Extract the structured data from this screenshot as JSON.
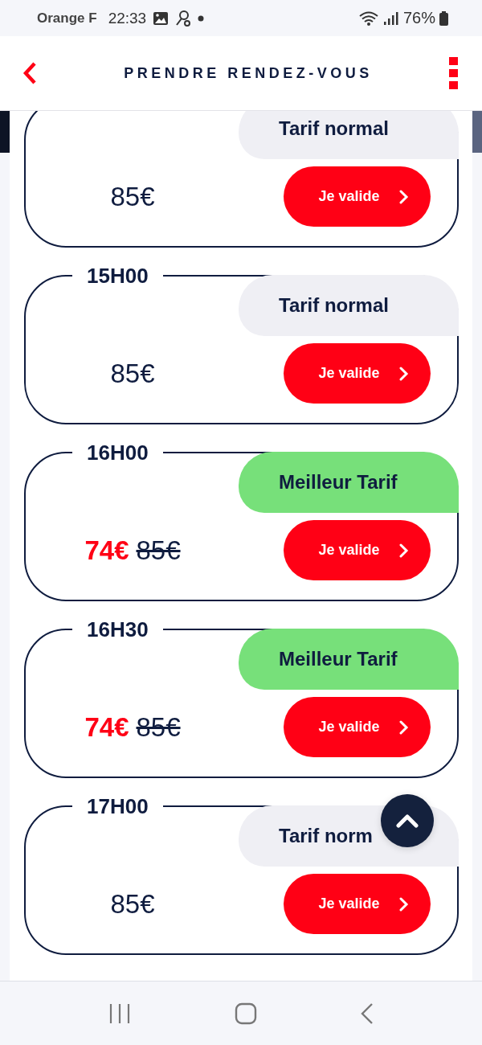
{
  "status_bar": {
    "carrier": "Orange F",
    "time": "22:33",
    "battery": "76%"
  },
  "header": {
    "title": "PRENDRE RENDEZ-VOUS"
  },
  "slots": [
    {
      "price": "85€",
      "badge": {
        "kind": "normal",
        "label": "Tarif normal"
      },
      "button": "Je valide"
    },
    {
      "time": "15H00",
      "price": "85€",
      "badge": {
        "kind": "normal",
        "label": "Tarif normal"
      },
      "button": "Je valide"
    },
    {
      "time": "16H00",
      "price": "74€",
      "old_price": "85€",
      "badge": {
        "kind": "best",
        "label": "Meilleur Tarif"
      },
      "button": "Je valide"
    },
    {
      "time": "16H30",
      "price": "74€",
      "old_price": "85€",
      "badge": {
        "kind": "best",
        "label": "Meilleur Tarif"
      },
      "button": "Je valide"
    },
    {
      "time": "17H00",
      "price": "85€",
      "badge": {
        "kind": "normal",
        "label": "Tarif norm"
      },
      "button": "Je valide"
    }
  ]
}
